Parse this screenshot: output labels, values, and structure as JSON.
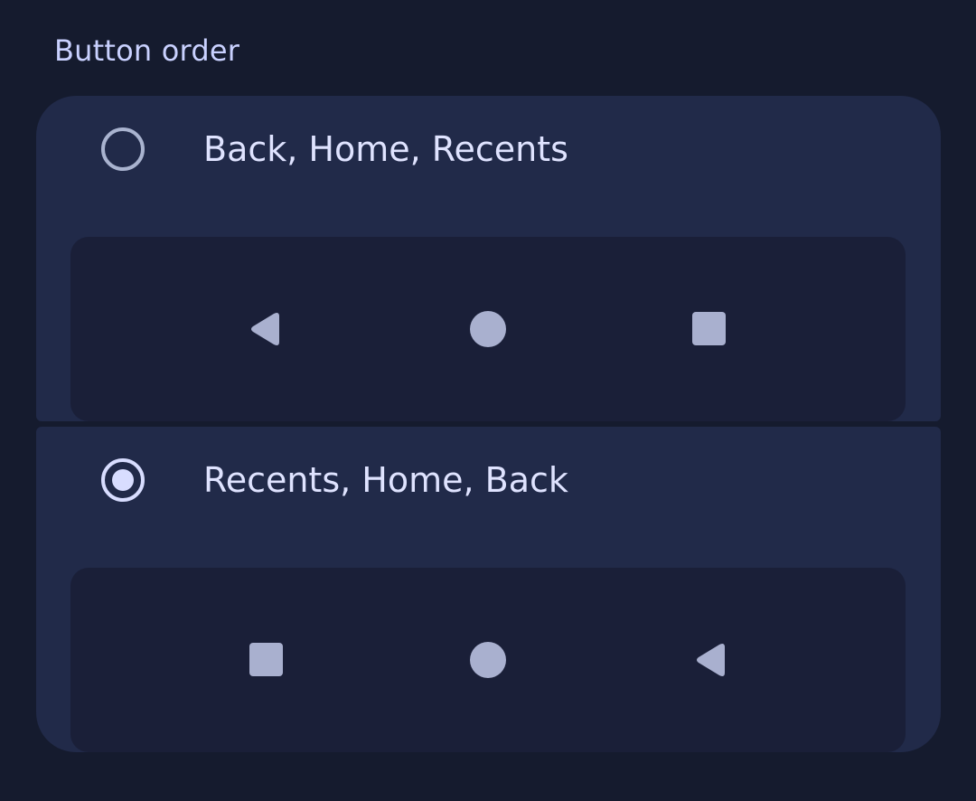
{
  "section": {
    "title": "Button order"
  },
  "options": [
    {
      "label": "Back, Home, Recents",
      "selected": false,
      "preview_icons": [
        "back-icon",
        "home-icon",
        "recents-icon"
      ]
    },
    {
      "label": "Recents, Home, Back",
      "selected": true,
      "preview_icons": [
        "recents-icon",
        "home-icon",
        "back-icon"
      ]
    }
  ],
  "colors": {
    "background": "#151b2e",
    "card": "#212a49",
    "preview": "#1a1f38",
    "icon": "#a9b0cf",
    "radio_selected": "#d8ddff",
    "radio_unselected": "#a9b3cf",
    "text": "#dfe3ff"
  }
}
